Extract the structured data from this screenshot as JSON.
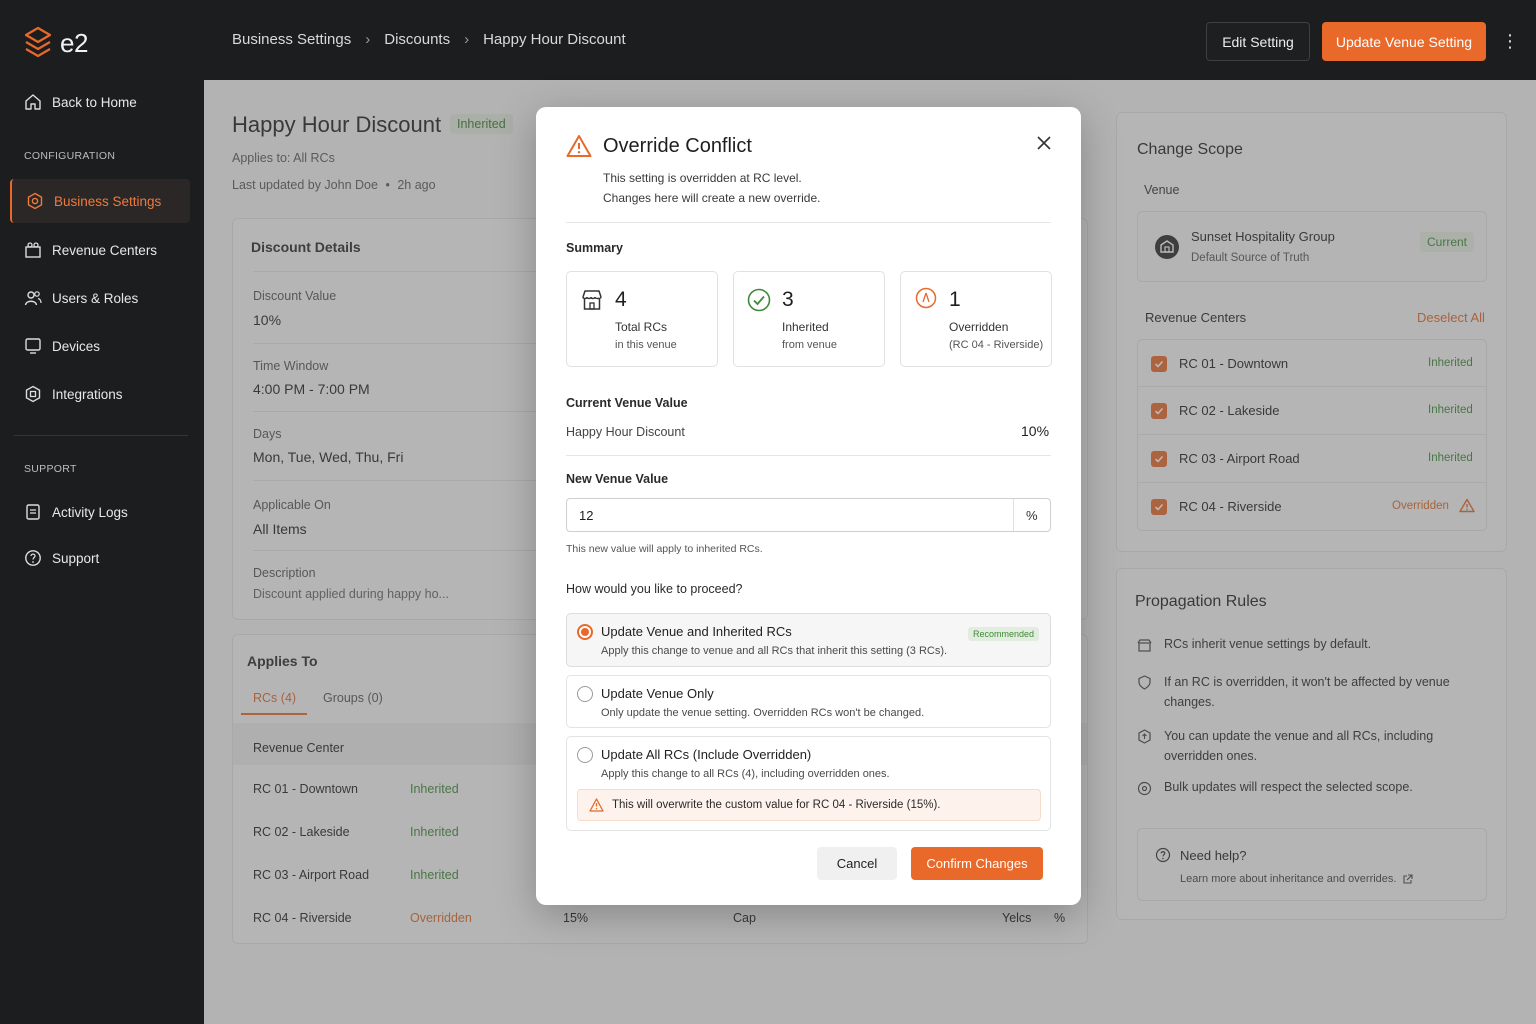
{
  "app": {
    "logo_text": "e2"
  },
  "sidebar": {
    "back": "Back to Home",
    "section_config": "CONFIGURATION",
    "items": [
      {
        "label": "Business Settings",
        "icon": "gear-icon"
      },
      {
        "label": "Revenue Centers",
        "icon": "building-icon"
      },
      {
        "label": "Users & Roles",
        "icon": "users-icon"
      },
      {
        "label": "Devices",
        "icon": "monitor-icon"
      },
      {
        "label": "Integrations",
        "icon": "integration-icon"
      }
    ],
    "section_support": "SUPPORT",
    "support_items": [
      {
        "label": "Activity Logs",
        "icon": "clipboard-icon"
      },
      {
        "label": "Support",
        "icon": "help-icon"
      }
    ]
  },
  "topbar": {
    "breadcrumb": [
      "Business Settings",
      "Discounts",
      "Happy Hour Discount"
    ],
    "edit_button": "Edit Setting",
    "update_button": "Update Venue Setting"
  },
  "page": {
    "title": "Happy Hour Discount",
    "badge": "Inherited",
    "applies_to": "Applies to: All RCs",
    "last_updated": "Last updated by John Doe",
    "updated_ago": "2h ago",
    "details": {
      "title": "Discount Details",
      "fields": [
        {
          "label": "Discount Value",
          "value": "10%"
        },
        {
          "label": "Time Window",
          "value": "4:00 PM - 7:00 PM"
        },
        {
          "label": "Days",
          "value": "Mon, Tue, Wed, Thu, Fri"
        },
        {
          "label": "Applicable On",
          "value": "All Items"
        },
        {
          "label": "Description",
          "value": "Discount applied during happy ho..."
        }
      ]
    },
    "applies_card": {
      "title": "Applies To",
      "tabs": [
        "RCs (4)",
        "Groups (0)"
      ],
      "col_header": "Revenue Center",
      "rows": [
        {
          "name": "RC 01 - Downtown",
          "status": "Inherited"
        },
        {
          "name": "RC 02 - Lakeside",
          "status": "Inherited"
        },
        {
          "name": "RC 03 - Airport Road",
          "status": "Inherited"
        },
        {
          "name": "RC 04 - Riverside",
          "status": "Overridden",
          "value": "15%",
          "col3": "Cap",
          "col4": "Yelcs",
          "col5": "%"
        }
      ]
    }
  },
  "scope": {
    "title": "Change Scope",
    "venue_label": "Venue",
    "venue_name": "Sunset Hospitality Group",
    "venue_sub": "Default Source of Truth",
    "venue_badge": "Current",
    "rc_title": "Revenue Centers",
    "deselect": "Deselect All",
    "rcs": [
      {
        "name": "RC 01 - Downtown",
        "status": "Inherited"
      },
      {
        "name": "RC 02 - Lakeside",
        "status": "Inherited"
      },
      {
        "name": "RC 03 - Airport Road",
        "status": "Inherited"
      },
      {
        "name": "RC 04 - Riverside",
        "status": "Overridden"
      }
    ]
  },
  "rules": {
    "title": "Propagation Rules",
    "items": [
      "RCs inherit venue settings by default.",
      "If an RC is overridden, it won't be affected by venue changes.",
      "You can update the venue and all RCs, including overridden ones.",
      "Bulk updates will respect the selected scope."
    ],
    "help_title": "Need help?",
    "help_link": "Learn more about inheritance and overrides."
  },
  "modal": {
    "title": "Override Conflict",
    "subtitle1": "This setting is overridden at RC level.",
    "subtitle2": "Changes here will create a new override.",
    "summary_label": "Summary",
    "summary": [
      {
        "num": "4",
        "l1": "Total RCs",
        "l2": "in this venue",
        "icon": "store-icon"
      },
      {
        "num": "3",
        "l1": "Inherited",
        "l2": "from venue",
        "icon": "check-circle-icon"
      },
      {
        "num": "1",
        "l1": "Overridden",
        "l2": "(RC 04 - Riverside)",
        "icon": "alert-circle-icon"
      }
    ],
    "current_label": "Current Venue Value",
    "current_name": "Happy Hour Discount",
    "current_value": "10%",
    "new_label": "New Venue Value",
    "new_value": "12",
    "new_suffix": "%",
    "new_hint": "This new value will apply to inherited RCs.",
    "proceed_label": "How would you like to proceed?",
    "options": [
      {
        "title": "Update Venue and Inherited RCs",
        "desc": "Apply this change to venue and all RCs that inherit this setting (3 RCs).",
        "badge": "Recommended",
        "selected": true
      },
      {
        "title": "Update Venue Only",
        "desc": "Only update the venue setting. Overridden RCs won't be changed.",
        "selected": false
      },
      {
        "title": "Update All RCs (Include Overridden)",
        "desc": "Apply this change to all RCs (4), including overridden ones.",
        "warning": "This will overwrite the custom value for RC 04 - Riverside (15%).",
        "selected": false
      }
    ],
    "cancel": "Cancel",
    "confirm": "Confirm Changes"
  },
  "colors": {
    "accent": "#e8692a",
    "inherited": "#3f8a38",
    "sidebar": "#1c1d1f"
  }
}
